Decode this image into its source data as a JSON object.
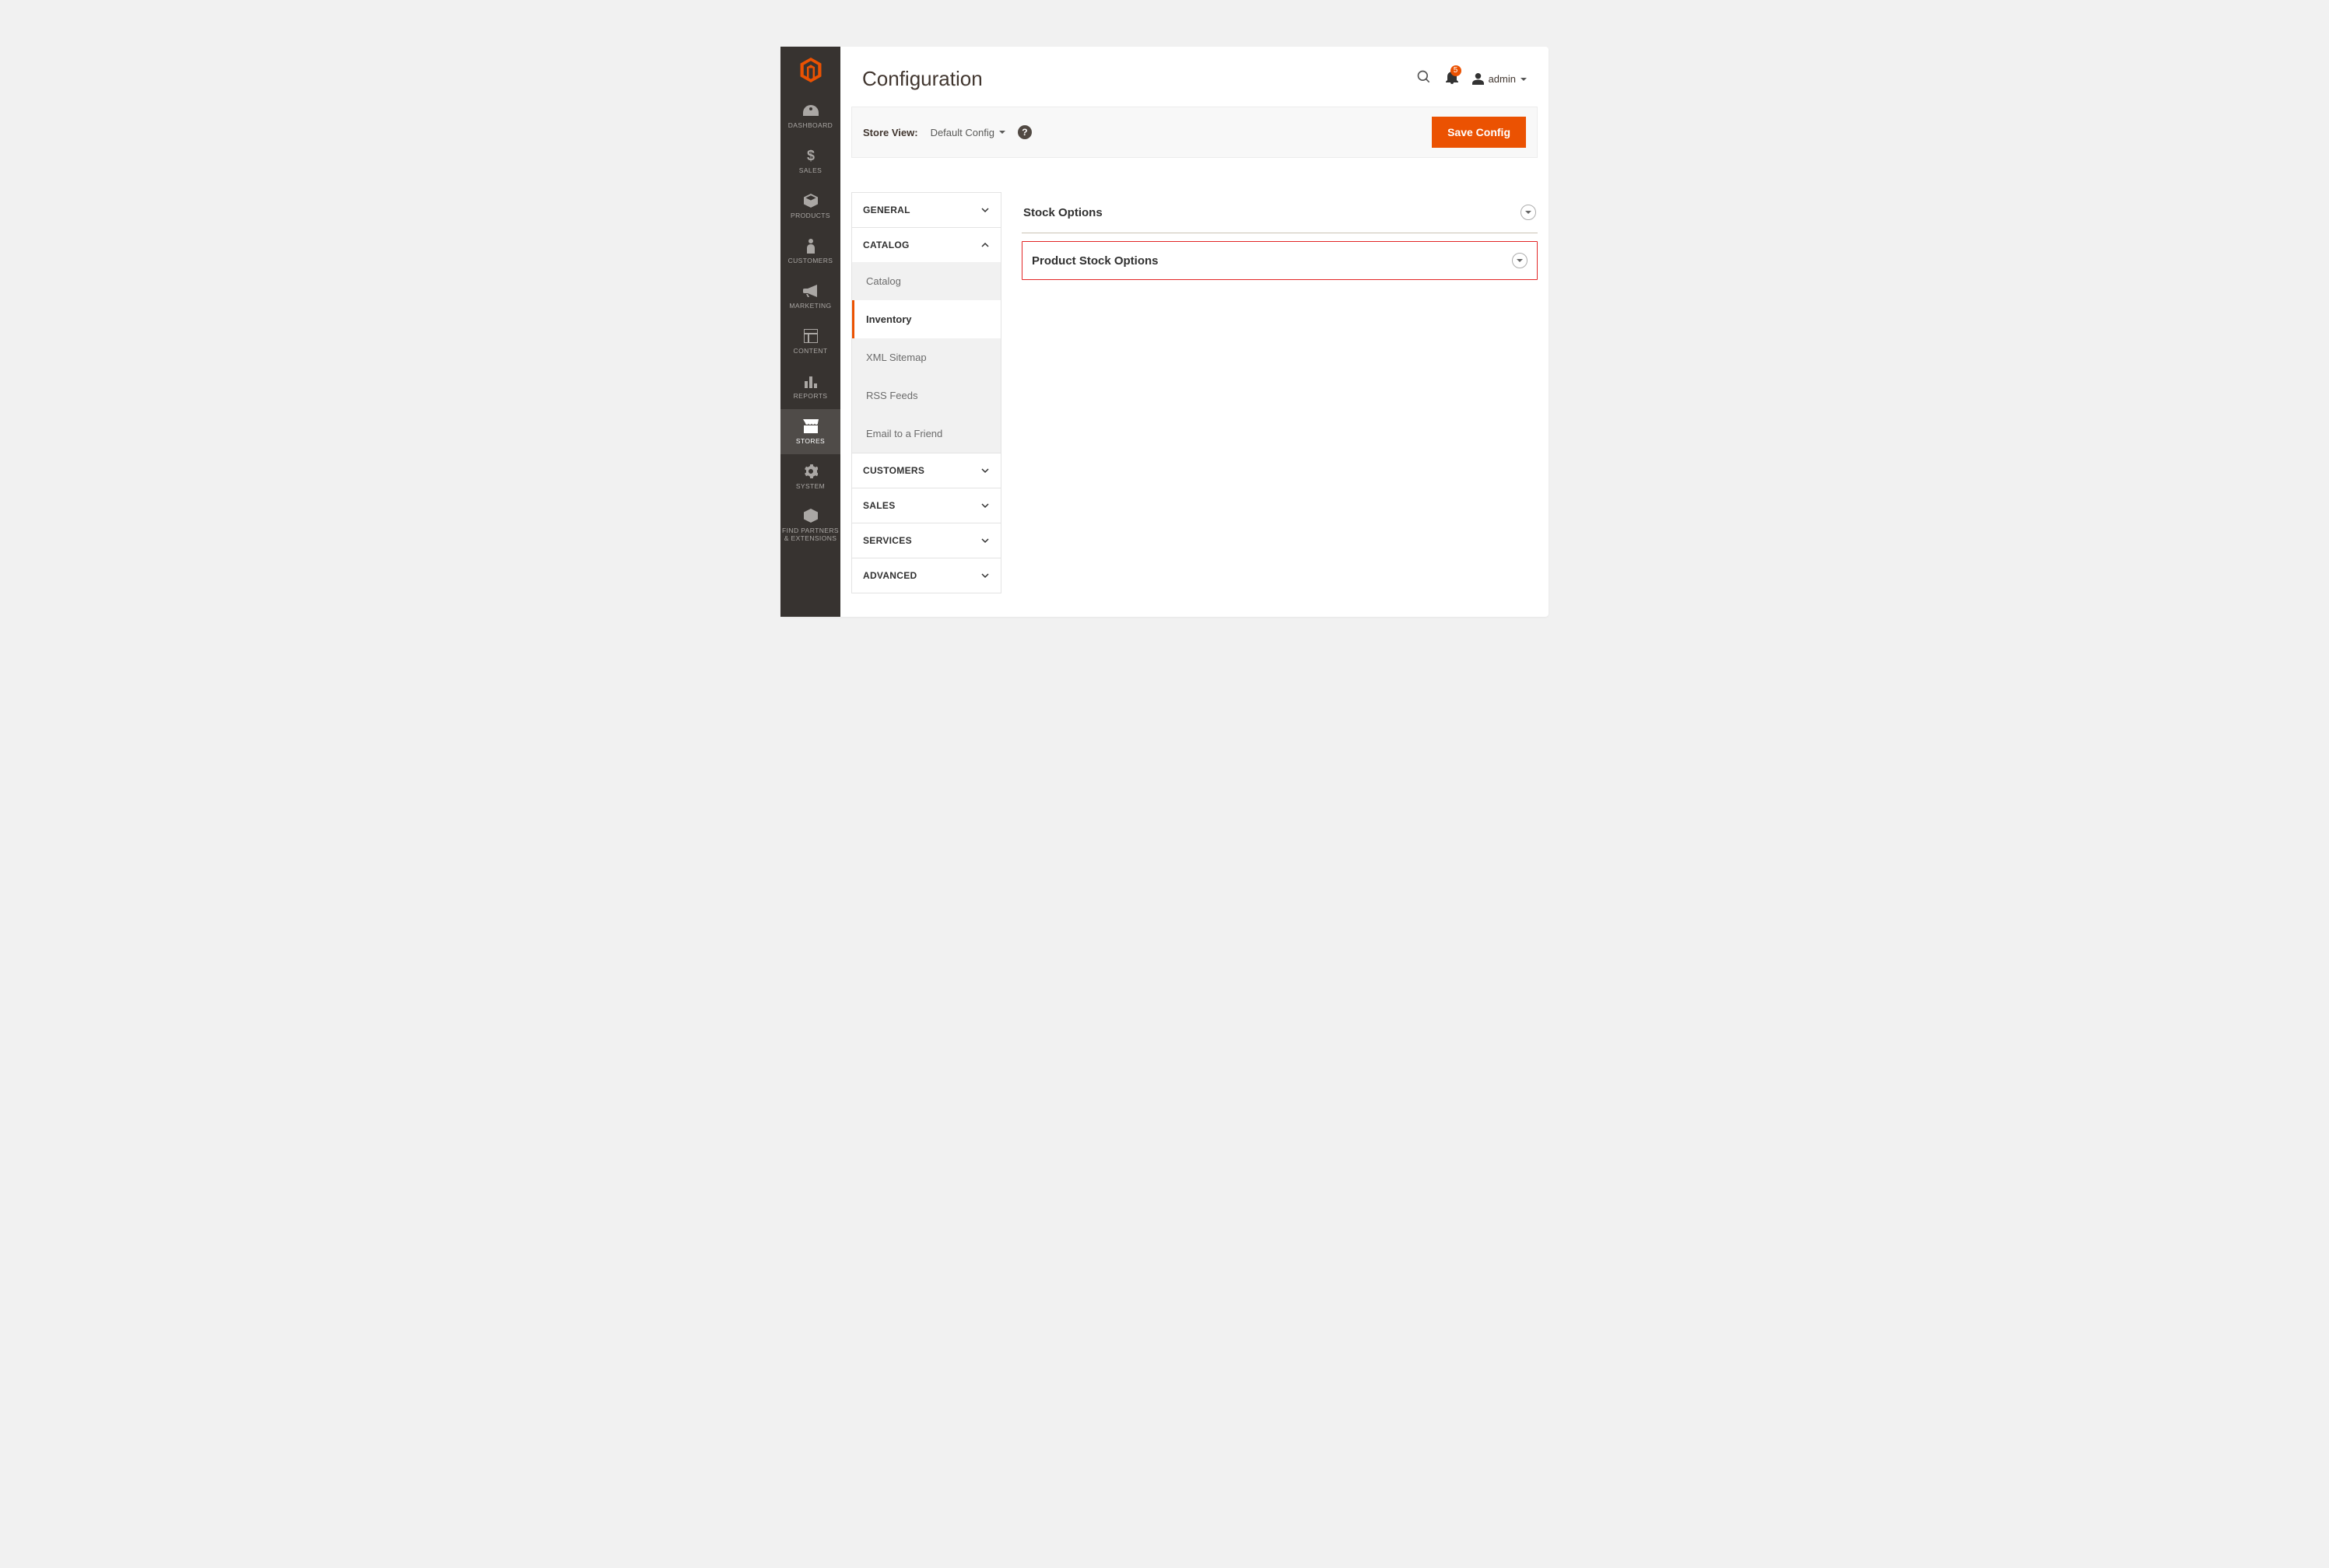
{
  "header": {
    "title": "Configuration",
    "notification_count": "5",
    "account_name": "admin"
  },
  "toolbar": {
    "store_view_label": "Store View:",
    "store_view_value": "Default Config",
    "save_label": "Save Config",
    "help_symbol": "?"
  },
  "sidebar": {
    "items": [
      {
        "label": "DASHBOARD"
      },
      {
        "label": "SALES"
      },
      {
        "label": "PRODUCTS"
      },
      {
        "label": "CUSTOMERS"
      },
      {
        "label": "MARKETING"
      },
      {
        "label": "CONTENT"
      },
      {
        "label": "REPORTS"
      },
      {
        "label": "STORES"
      },
      {
        "label": "SYSTEM"
      },
      {
        "label": "FIND PARTNERS\n& EXTENSIONS"
      }
    ]
  },
  "config_tree": {
    "categories": {
      "general": {
        "label": "GENERAL"
      },
      "catalog": {
        "label": "CATALOG"
      },
      "customers": {
        "label": "CUSTOMERS"
      },
      "sales": {
        "label": "SALES"
      },
      "services": {
        "label": "SERVICES"
      },
      "advanced": {
        "label": "ADVANCED"
      }
    },
    "catalog_subitems": {
      "catalog": {
        "label": "Catalog"
      },
      "inventory": {
        "label": "Inventory"
      },
      "xml": {
        "label": "XML Sitemap"
      },
      "rss": {
        "label": "RSS Feeds"
      },
      "email": {
        "label": "Email to a Friend"
      }
    }
  },
  "panels": {
    "stock_options": {
      "title": "Stock Options"
    },
    "product_stock_options": {
      "title": "Product Stock Options"
    }
  }
}
